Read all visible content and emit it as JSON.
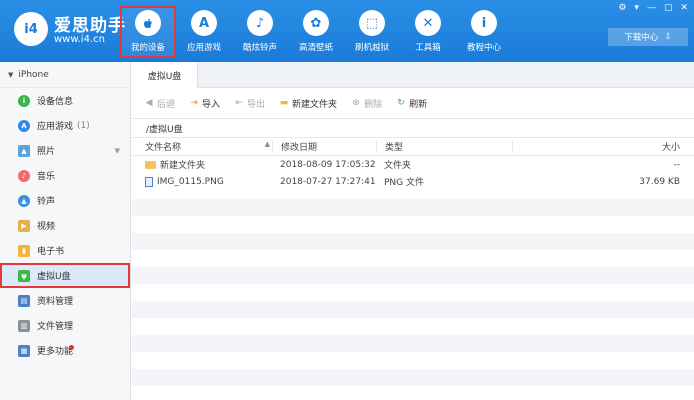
{
  "app": {
    "name": "爱思助手",
    "url": "www.i4.cn",
    "logo_text": "i4"
  },
  "nav": [
    {
      "label": "我的设备",
      "icon": "apple-icon",
      "glyph": "",
      "active": true
    },
    {
      "label": "应用游戏",
      "icon": "appstore-icon",
      "glyph": "A"
    },
    {
      "label": "酷炫铃声",
      "icon": "bell-icon",
      "glyph": "♪"
    },
    {
      "label": "高清壁纸",
      "icon": "flower-icon",
      "glyph": "✿"
    },
    {
      "label": "刷机越狱",
      "icon": "box-icon",
      "glyph": "⬚"
    },
    {
      "label": "工具箱",
      "icon": "tools-icon",
      "glyph": "✕"
    },
    {
      "label": "教程中心",
      "icon": "info-icon",
      "glyph": "i"
    }
  ],
  "window": {
    "download_center": "下载中心"
  },
  "sidebar": {
    "device": "iPhone",
    "items": [
      {
        "label": "设备信息",
        "icon": "info-icon",
        "color": "#3cb54a",
        "glyph": "i"
      },
      {
        "label": "应用游戏",
        "count": "(1)",
        "icon": "appstore-icon",
        "color": "#2f8be6",
        "glyph": "A"
      },
      {
        "label": "照片",
        "icon": "photo-icon",
        "color": "#5ba3e0",
        "glyph": "▲"
      },
      {
        "label": "音乐",
        "icon": "music-icon",
        "color": "#f06a6a",
        "glyph": "♪"
      },
      {
        "label": "铃声",
        "icon": "bell-icon",
        "color": "#3a8fe0",
        "glyph": "▲"
      },
      {
        "label": "视频",
        "icon": "video-icon",
        "color": "#e8b04a",
        "glyph": "▶"
      },
      {
        "label": "电子书",
        "icon": "book-icon",
        "color": "#f2b63f",
        "glyph": "▮"
      },
      {
        "label": "虚拟U盘",
        "icon": "usb-icon",
        "color": "#3cb54a",
        "glyph": "ψ",
        "active": true
      },
      {
        "label": "资料管理",
        "icon": "contacts-icon",
        "color": "#4a7fc9",
        "glyph": "▤"
      },
      {
        "label": "文件管理",
        "icon": "files-icon",
        "color": "#8a8f98",
        "glyph": "▥"
      },
      {
        "label": "更多功能",
        "icon": "grid-icon",
        "color": "#4a7fc9",
        "glyph": "▦"
      }
    ]
  },
  "main": {
    "tab": "虚拟U盘",
    "toolbar": {
      "back": "后退",
      "import": "导入",
      "export": "导出",
      "new_folder": "新建文件夹",
      "delete": "删除",
      "refresh": "刷新"
    },
    "path": "/虚拟U盘",
    "columns": {
      "name": "文件名称",
      "date": "修改日期",
      "type": "类型",
      "size": "大小"
    },
    "rows": [
      {
        "name": "新建文件夹",
        "date": "2018-08-09 17:05:32",
        "type": "文件夹",
        "size": "--",
        "icon": "folder-icon"
      },
      {
        "name": "IMG_0115.PNG",
        "date": "2018-07-27 17:27:41",
        "type": "PNG 文件",
        "size": "37.69 KB",
        "icon": "png-file-icon"
      }
    ]
  }
}
